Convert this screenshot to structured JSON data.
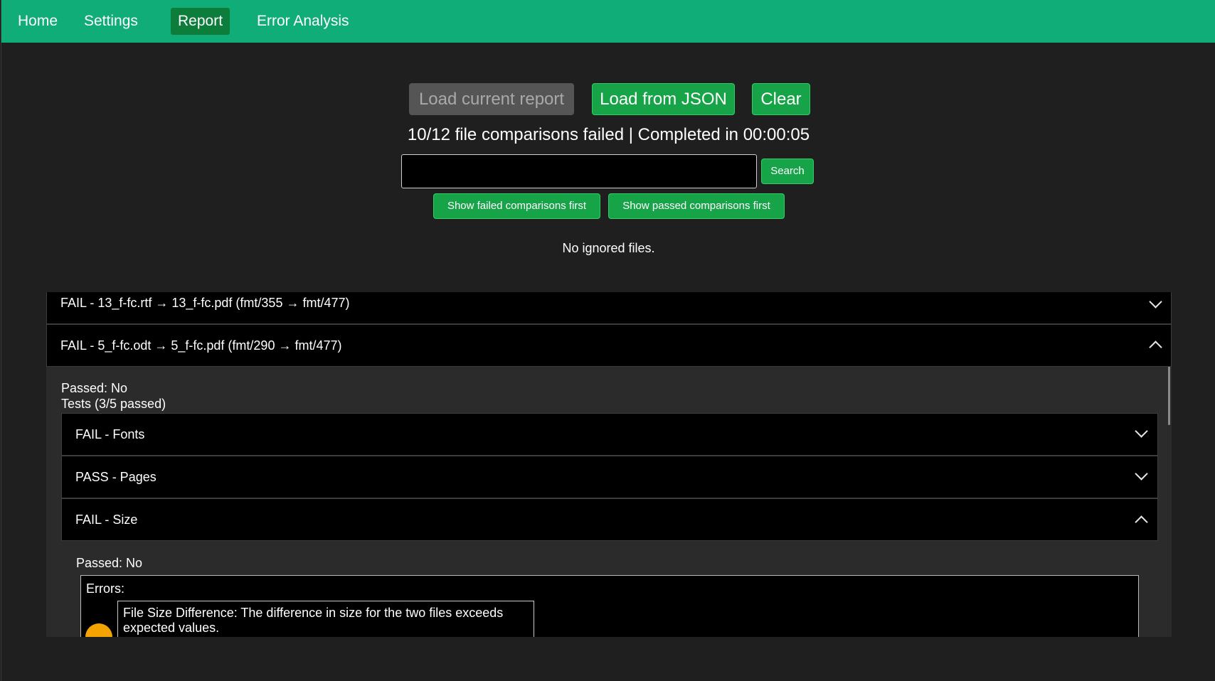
{
  "nav": {
    "items": [
      "Home",
      "Settings",
      "Report",
      "Error Analysis"
    ],
    "active": "Report"
  },
  "toolbar": {
    "load_current": "Load current report",
    "load_json": "Load from JSON",
    "clear": "Clear"
  },
  "status": "10/12 file comparisons failed | Completed in 00:00:05",
  "search": {
    "value": "",
    "placeholder": "",
    "button": "Search"
  },
  "sort": {
    "failed_first": "Show failed comparisons first",
    "passed_first": "Show passed comparisons first"
  },
  "ignored_text": "No ignored files.",
  "comparisons": [
    {
      "title": "FAIL - 13_f-fc.rtf  → 13_f-fc.pdf (fmt/355 → fmt/477)",
      "expanded": false
    },
    {
      "title": "FAIL - 5_f-fc.odt  → 5_f-fc.pdf (fmt/290 → fmt/477)",
      "expanded": true,
      "passed": "Passed: No",
      "tests_summary": "Tests (3/5 passed)",
      "tests": [
        {
          "title": "FAIL - Fonts",
          "expanded": false
        },
        {
          "title": "PASS - Pages",
          "expanded": false
        },
        {
          "title": "FAIL - Size",
          "expanded": true,
          "passed": "Passed: No",
          "errors_label": "Errors:",
          "errors": [
            "File Size Difference: The difference in size for the two files exceeds expected values."
          ]
        }
      ]
    }
  ],
  "colors": {
    "navbar": "#10ad78",
    "active_tab": "#0c7d3b",
    "button": "#17a348",
    "warning": "#f5a300"
  },
  "icons": {
    "collapsed": "chevron-down-icon",
    "expanded": "chevron-up-icon",
    "severity": "warning-dot-icon"
  }
}
